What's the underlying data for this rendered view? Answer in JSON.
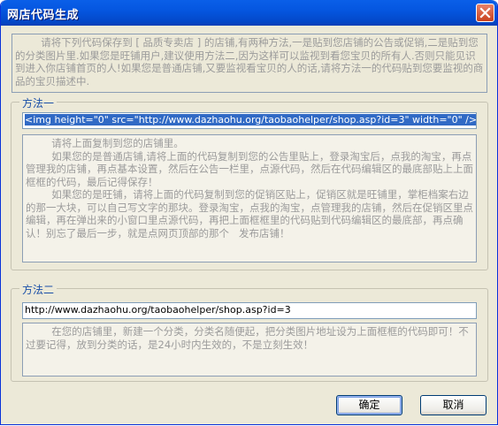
{
  "window": {
    "title": "网店代码生成"
  },
  "intro_text": "        请将下列代码保存到 [ 品质专卖店 ] 的店铺,有两种方法,一是贴到您店铺的公告或促销,二是贴到您的分类图片里.如果您是旺铺用户,建议使用方法二,因为这样可以监视到看您宝贝的所有人.否则只能见识到进入你店铺首页的人!如果您是普通店铺,又要监视看宝贝的人的话,请将方法一的代码贴到您要监视的商品的宝贝描述中.",
  "method1": {
    "label": "方法一",
    "code": "<img height=\"0\" src=\"http://www.dazhaohu.org/taobaohelper/shop.asp?id=3\" width=\"0\" />",
    "instructions": "        请将上面复制到您的店铺里。\n        如果您的是普通店铺,请将上面的代码复制到您的公告里贴上，登录淘宝后，点我的淘宝，再点管理我的店铺，再点基本设置，然后在公告一栏里，点源代码，然后在代码编辑区的最底部贴上上面框框的代码，最后记得保存！\n        如果您的是旺铺，请将上面的代码复制到您的促销区贴上，促销区就是旺铺里，掌柜档案右边的那一大块，可以自己写文字的那块。登录淘宝，点我的淘宝，点管理我的店铺，然后在促销区里点编辑，再在弹出来的小窗口里点源代码，再把上面框框里的代码贴到代码编辑区的最底部，再点确认！别忘了最后一步，就是点网页顶部的那个   发布店铺！"
  },
  "method2": {
    "label": "方法二",
    "url": "http://www.dazhaohu.org/taobaohelper/shop.asp?id=3",
    "instructions": "        在您的店铺里，新建一个分类，分类名随便起，把分类图片地址设为上面框框的代码即可！不过要记得，放到分类的话，是24小时内生效的，不是立刻生效！"
  },
  "buttons": {
    "ok": "确定",
    "cancel": "取消"
  },
  "colors": {
    "title_bar": "#0556E0",
    "dialog_bg": "#ECE9D8",
    "selection": "#316AC5",
    "group_label": "#1A4FA8"
  }
}
